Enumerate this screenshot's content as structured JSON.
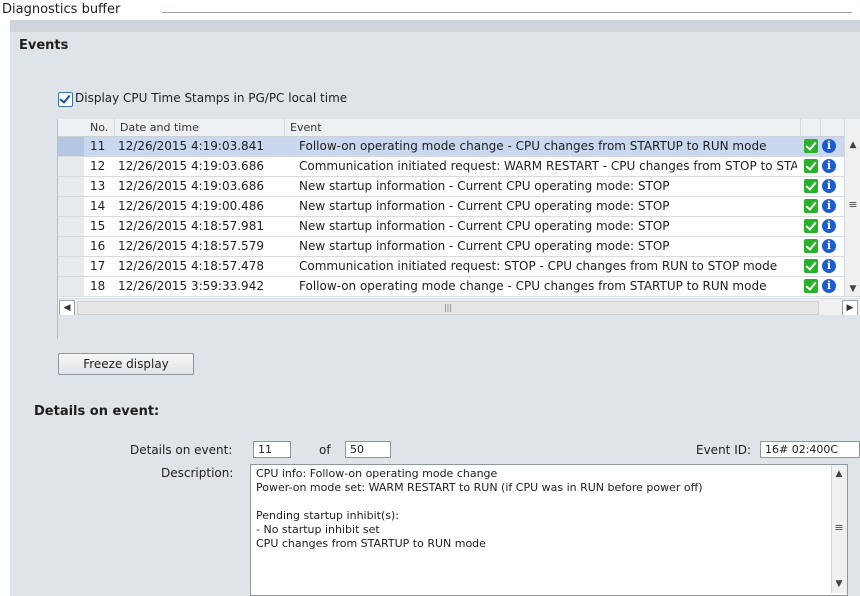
{
  "window": {
    "title": "Diagnostics buffer"
  },
  "events": {
    "section_title": "Events",
    "checkbox_label": "Display CPU Time Stamps in PG/PC local time",
    "checkbox_checked": true,
    "columns": {
      "no": "No.",
      "datetime": "Date and time",
      "event": "Event"
    },
    "rows": [
      {
        "no": "11",
        "datetime": "12/26/2015 4:19:03.841",
        "event": "Follow-on operating mode change  - CPU changes from STARTUP to RUN mode",
        "selected": true
      },
      {
        "no": "12",
        "datetime": "12/26/2015 4:19:03.686",
        "event": "Communication initiated request: WARM RESTART  - CPU changes from STOP to STARTUP",
        "selected": false
      },
      {
        "no": "13",
        "datetime": "12/26/2015 4:19:03.686",
        "event": "New startup information  - Current CPU operating mode: STOP",
        "selected": false
      },
      {
        "no": "14",
        "datetime": "12/26/2015 4:19:00.486",
        "event": "New startup information  - Current CPU operating mode: STOP",
        "selected": false
      },
      {
        "no": "15",
        "datetime": "12/26/2015 4:18:57.981",
        "event": "New startup information  - Current CPU operating mode: STOP",
        "selected": false
      },
      {
        "no": "16",
        "datetime": "12/26/2015 4:18:57.579",
        "event": "New startup information  - Current CPU operating mode: STOP",
        "selected": false
      },
      {
        "no": "17",
        "datetime": "12/26/2015 4:18:57.478",
        "event": "Communication initiated request: STOP  - CPU changes from RUN to STOP mode",
        "selected": false
      },
      {
        "no": "18",
        "datetime": "12/26/2015 3:59:33.942",
        "event": "Follow-on operating mode change  - CPU changes from STARTUP to RUN mode",
        "selected": false
      }
    ],
    "status_icons": [
      "check-icon",
      "info-icon"
    ],
    "freeze_button": "Freeze display"
  },
  "details": {
    "section_title": "Details on event:",
    "details_label": "Details on event:",
    "current": "11",
    "of_label": "of",
    "total": "50",
    "event_id_label": "Event ID:",
    "event_id": "16# 02:400C",
    "description_label": "Description:",
    "description_lines": [
      "CPU info: Follow-on operating mode change",
      "Power-on mode set: WARM RESTART to RUN (if CPU was in RUN before power off)",
      "",
      "Pending startup inhibit(s):",
      " - No startup inhibit set",
      "  CPU changes from STARTUP to RUN mode"
    ]
  },
  "colors": {
    "panel": "#dfe4e8",
    "selection": "#c9d8ee",
    "ok_green": "#2bb02b",
    "info_blue": "#1c5bd0"
  }
}
